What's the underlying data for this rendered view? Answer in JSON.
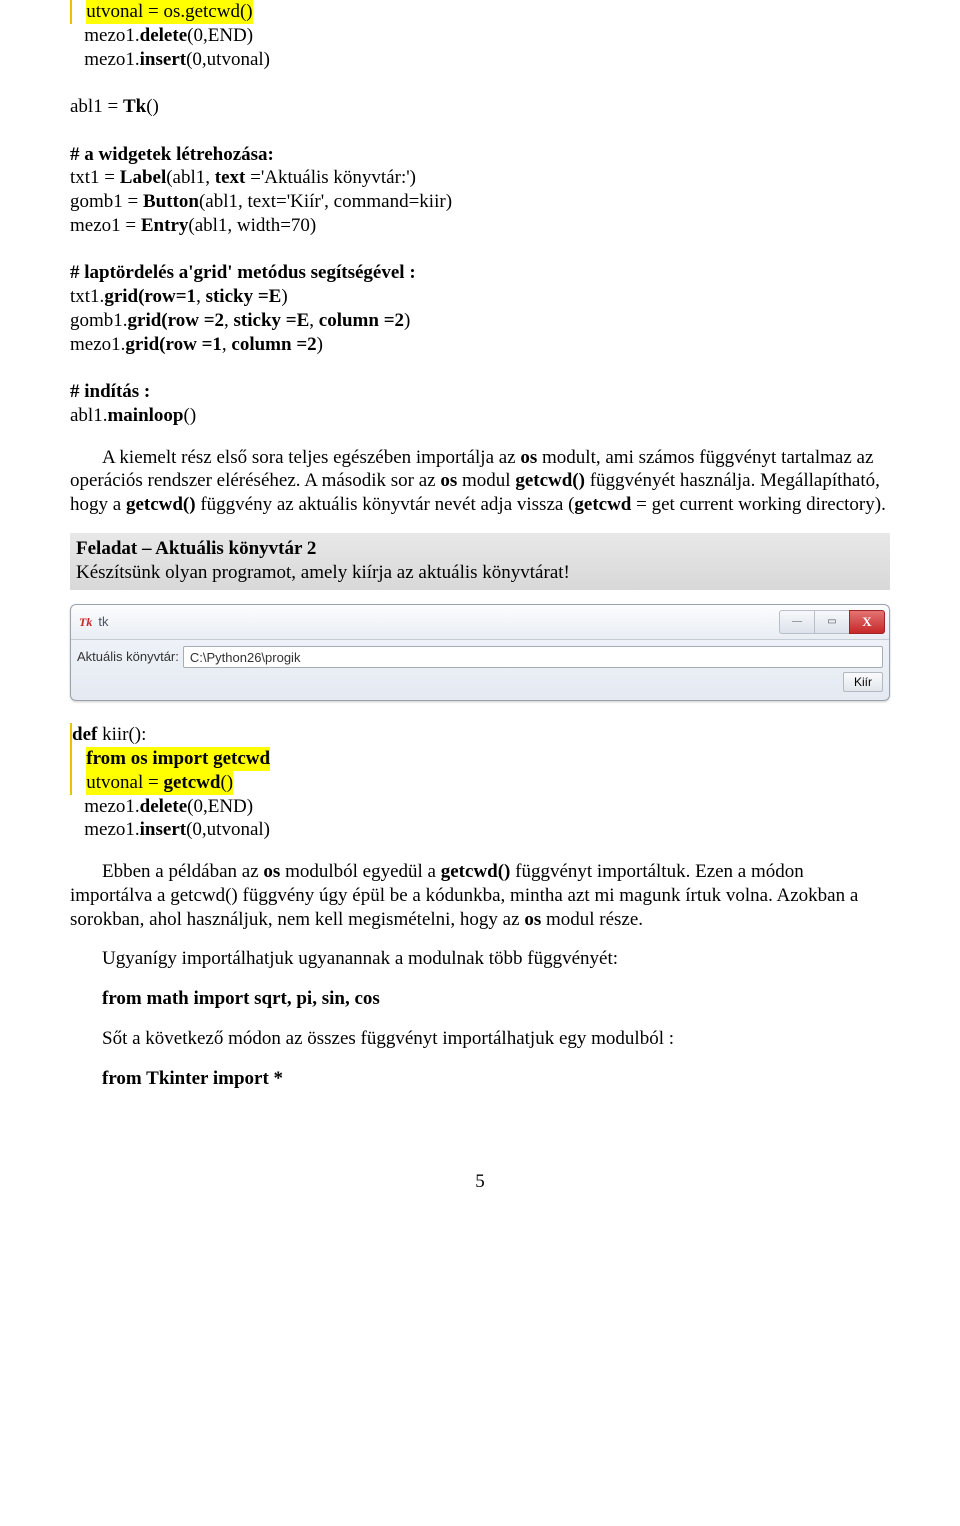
{
  "codeA": {
    "l1_pre": "   ",
    "l1": "utvonal = os.getcwd()",
    "l2_pre": "   mezo1.",
    "l2b": "delete",
    "l2c": "(0,END)",
    "l3_pre": "   mezo1.",
    "l3b": "insert",
    "l3c": "(0,utvonal)",
    "l4": "",
    "l5a": "abl1 = ",
    "l5b": "Tk",
    "l5c": "()",
    "l6": "",
    "l7": "# a widgetek létrehozása:",
    "l8a": "txt1 = ",
    "l8b": "Label",
    "l8c": "(abl1, ",
    "l8d": "text",
    "l8e": " ='Aktuális könyvtár:')",
    "l9a": "gomb1 = ",
    "l9b": "Button",
    "l9c": "(abl1, text='Kiír', command=kiir)",
    "l10a": "mezo1 = ",
    "l10b": "Entry",
    "l10c": "(abl1, width=70)",
    "l11": "",
    "l12": "# laptördelés a'grid' metódus segítségével :",
    "l13a": "txt1.",
    "l13b": "grid(row=1",
    "l13c": ", ",
    "l13d": "sticky =E",
    "l13e": ")",
    "l14a": "gomb1.",
    "l14b": "grid(row =2",
    "l14c": ", ",
    "l14d": "sticky =E",
    "l14e": ", ",
    "l14f": "column =2",
    "l14g": ")",
    "l15a": "mezo1.",
    "l15b": "grid(row =1",
    "l15c": ", ",
    "l15d": "column =2",
    "l15e": ")",
    "l16": "",
    "l17": "# indítás :",
    "l18a": "abl1.",
    "l18b": "mainloop",
    "l18c": "()"
  },
  "para1a": "A kiemelt rész első sora teljes egészében importálja az ",
  "para1b": "os",
  "para1c": " modult, ami számos függvényt tartalmaz az operációs rendszer eléréséhez. A második sor az ",
  "para1d": "os",
  "para1e": " modul ",
  "para1f": "getcwd()",
  "para1g": " függvényét használja. Megállapítható, hogy a ",
  "para1h": "getcwd()",
  "para1i": " függvény az aktuális könyvtár nevét adja vissza (",
  "para1j": "getcwd",
  "para1k": " = get current working directory).",
  "task": {
    "title": "Feladat – Aktuális könyvtár 2",
    "text": "Készítsünk olyan programot, amely kiírja az aktuális könyvtárat!"
  },
  "window": {
    "title": "tk",
    "label": "Aktuális könyvtár:",
    "value": "C:\\Python26\\progik",
    "button": "Kiír"
  },
  "codeB": {
    "l1a": "def",
    "l1b": " kiir():",
    "l2_pre": "   ",
    "l2h": "from os import getcwd",
    "l3_pre": "   ",
    "l3a": "utvonal = ",
    "l3b": "getcwd",
    "l3c": "()",
    "l4_pre": "   mezo1.",
    "l4b": "delete",
    "l4c": "(0,END)",
    "l5_pre": "   mezo1.",
    "l5b": "insert",
    "l5c": "(0,utvonal)"
  },
  "para2a": "Ebben a példában az ",
  "para2b": "os",
  "para2c": " modulból egyedül a ",
  "para2d": "getcwd()",
  "para2e": " függvényt importáltuk. Ezen a módon importálva a getcwd() függvény úgy épül be a kódunkba, mintha azt mi magunk írtuk volna. Azokban a sorokban, ahol használjuk, nem kell megismételni, hogy az ",
  "para2f": "os",
  "para2g": " modul része.",
  "para3": "Ugyanígy importálhatjuk ugyanannak a modulnak több függvényét:",
  "import1": "from math import sqrt, pi, sin, cos",
  "para4": "Sőt a következő módon az összes függvényt importálhatjuk egy modulból :",
  "import2": "from Tkinter import *",
  "pageNum": "5"
}
